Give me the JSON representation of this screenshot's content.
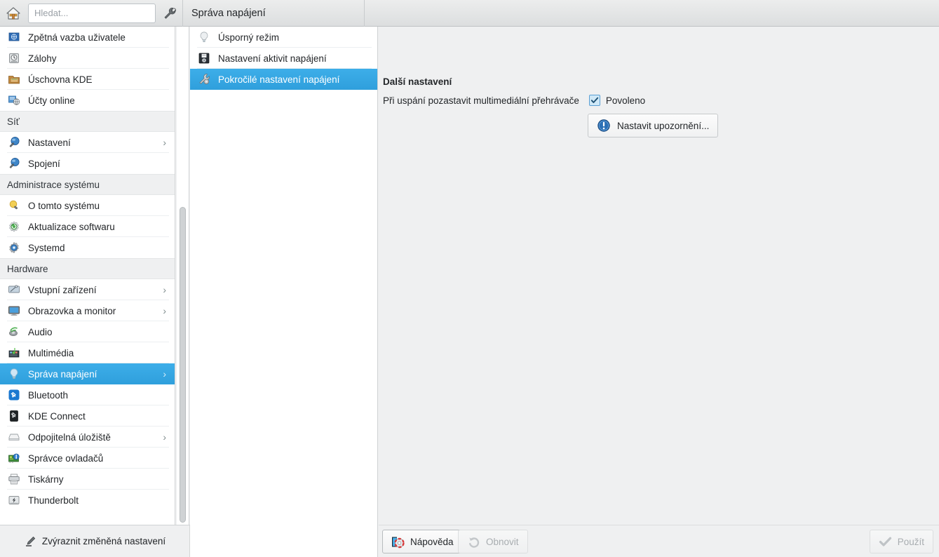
{
  "header": {
    "home_icon": "home-icon",
    "search_placeholder": "Hledat...",
    "search_value": "",
    "configure_icon": "wrench-icon",
    "module_title": "Správa napájení",
    "page_title": "Pokročilé nastavení napájení"
  },
  "sidebar": {
    "groups": [
      {
        "label": "",
        "items": [
          {
            "label": "Zpětná vazba uživatele",
            "icon": "user-feedback-icon",
            "has_chevron": false,
            "selected": false
          },
          {
            "label": "Zálohy",
            "icon": "backup-drive-icon",
            "has_chevron": false,
            "selected": false
          },
          {
            "label": "Úschovna KDE",
            "icon": "kde-vault-icon",
            "has_chevron": false,
            "selected": false
          },
          {
            "label": "Účty online",
            "icon": "online-accounts-icon",
            "has_chevron": false,
            "selected": false
          }
        ]
      },
      {
        "label": "Síť",
        "items": [
          {
            "label": "Nastavení",
            "icon": "network-settings-icon",
            "has_chevron": true,
            "selected": false
          },
          {
            "label": "Spojení",
            "icon": "network-connections-icon",
            "has_chevron": false,
            "selected": false
          }
        ]
      },
      {
        "label": "Administrace systému",
        "items": [
          {
            "label": "O tomto systému",
            "icon": "about-system-icon",
            "has_chevron": false,
            "selected": false
          },
          {
            "label": "Aktualizace softwaru",
            "icon": "software-update-icon",
            "has_chevron": false,
            "selected": false
          },
          {
            "label": "Systemd",
            "icon": "systemd-icon",
            "has_chevron": false,
            "selected": false
          }
        ]
      },
      {
        "label": "Hardware",
        "items": [
          {
            "label": "Vstupní zařízení",
            "icon": "input-devices-icon",
            "has_chevron": true,
            "selected": false
          },
          {
            "label": "Obrazovka a monitor",
            "icon": "display-monitor-icon",
            "has_chevron": true,
            "selected": false
          },
          {
            "label": "Audio",
            "icon": "audio-icon",
            "has_chevron": false,
            "selected": false
          },
          {
            "label": "Multimédia",
            "icon": "multimedia-icon",
            "has_chevron": false,
            "selected": false
          },
          {
            "label": "Správa napájení",
            "icon": "power-management-icon",
            "has_chevron": true,
            "selected": true
          },
          {
            "label": "Bluetooth",
            "icon": "bluetooth-icon",
            "has_chevron": false,
            "selected": false
          },
          {
            "label": "KDE Connect",
            "icon": "kde-connect-icon",
            "has_chevron": false,
            "selected": false
          },
          {
            "label": "Odpojitelná úložiště",
            "icon": "removable-storage-icon",
            "has_chevron": true,
            "selected": false
          },
          {
            "label": "Správce ovladačů",
            "icon": "driver-manager-icon",
            "has_chevron": false,
            "selected": false
          },
          {
            "label": "Tiskárny",
            "icon": "printer-icon",
            "has_chevron": false,
            "selected": false
          },
          {
            "label": "Thunderbolt",
            "icon": "thunderbolt-icon",
            "has_chevron": false,
            "selected": false
          }
        ]
      }
    ],
    "footer": {
      "label": "Zvýraznit změněná nastavení",
      "icon": "highlight-marker-icon"
    }
  },
  "midpanel": {
    "items": [
      {
        "label": "Úsporný režim",
        "icon": "lightbulb-icon",
        "selected": false
      },
      {
        "label": "Nastavení aktivit napájení",
        "icon": "activity-power-icon",
        "selected": false
      },
      {
        "label": "Pokročilé nastavení napájení",
        "icon": "wrench-gear-icon",
        "selected": true
      }
    ]
  },
  "main": {
    "section_title": "Další nastavení",
    "setting_label": "Při uspání pozastavit multimediální přehrávače",
    "checkbox_checked": true,
    "checkbox_label": "Povoleno",
    "notify_button": {
      "label": "Nastavit upozornění...",
      "icon": "notification-exclamation-icon"
    }
  },
  "buttonbar": {
    "help": {
      "label": "Nápověda",
      "icon": "help-lifering-icon",
      "enabled": true
    },
    "reset": {
      "label": "Obnovit",
      "icon": "undo-arrow-icon",
      "enabled": false
    },
    "apply": {
      "label": "Použít",
      "icon": "checkmark-icon",
      "enabled": false
    }
  },
  "colors": {
    "accent": "#3daee9",
    "window_bg": "#eff0f1",
    "list_bg": "#ffffff",
    "text": "#232629"
  }
}
